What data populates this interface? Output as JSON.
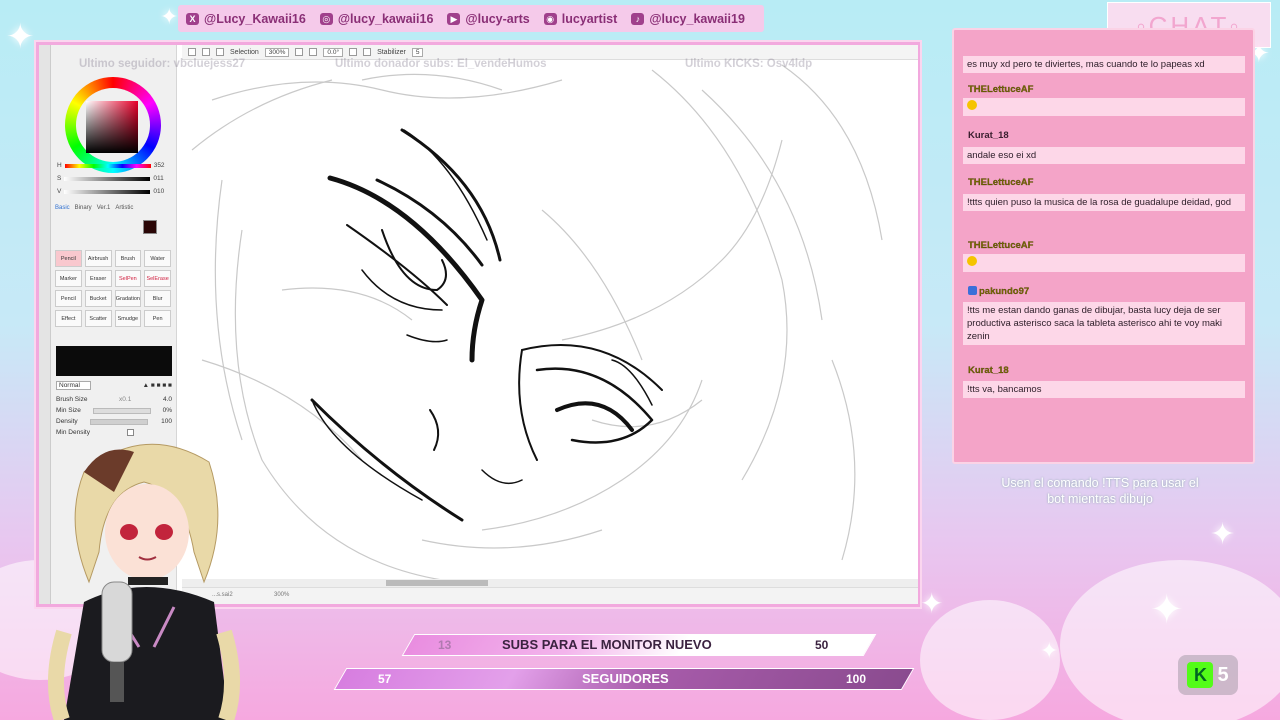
{
  "social": [
    {
      "icon": "x-icon",
      "glyph": "X",
      "handle": "@Lucy_Kawaii16"
    },
    {
      "icon": "instagram-icon",
      "glyph": "◎",
      "handle": "@lucy_kawaii16"
    },
    {
      "icon": "youtube-icon",
      "glyph": "▶",
      "handle": "@lucy-arts"
    },
    {
      "icon": "discord-icon",
      "glyph": "◉",
      "handle": "lucyartist"
    },
    {
      "icon": "tiktok-icon",
      "glyph": "♪",
      "handle": "@lucy_kawaii19"
    }
  ],
  "app": {
    "toolbar": {
      "selection": "Selection",
      "zoom": "300%",
      "angle": "0.0°",
      "stabilizer_label": "Stabilizer",
      "stabilizer_value": "5"
    },
    "color": {
      "h_label": "H",
      "h_value": "352",
      "s_label": "S",
      "s_value": "011",
      "v_label": "V",
      "v_value": "010",
      "accent": "#e8002a"
    },
    "brush_tabs": [
      "Basic",
      "Binary",
      "Ver.1",
      "Artistic"
    ],
    "tools": [
      "Pencil",
      "Airbrush",
      "Brush",
      "Water Color",
      "Marker",
      "Eraser",
      "SelPen",
      "SelErase",
      "Pencil",
      "Bucket",
      "Gradation",
      "Blur",
      "Effect",
      "Scatter",
      "Smudge",
      "Pen"
    ],
    "brush": {
      "mode": "Normal",
      "size_label": "Brush Size",
      "size_mult": "x0.1",
      "size_value": "4.0",
      "min_size_label": "Min Size",
      "min_size_value": "0%",
      "density_label": "Density",
      "density_value": "100",
      "min_density_label": "Min Density"
    },
    "overlays": {
      "follower": "Ultimo seguidor: vbcluejess27",
      "donor": "Ultimo donador subs: El_vendeHumos",
      "kicks": "Ultimo KICKS: Osv4ldp"
    },
    "status": {
      "file": "...s.sai2",
      "zoom": "300%"
    }
  },
  "chat": {
    "label": "◦CHAT◦",
    "messages": [
      {
        "user": "",
        "text": "es muy xd pero te diviertes, mas cuando te lo papeas xd"
      },
      {
        "user": "THELettuceAF",
        "text": "",
        "emote": true
      },
      {
        "user": "Kurat_18",
        "text": "andale eso ei xd"
      },
      {
        "user": "THELettuceAF",
        "text": "!ttts quien puso la musica de la rosa de guadalupe deidad, god"
      },
      {
        "user": "THELettuceAF",
        "text": "",
        "emote": true
      },
      {
        "user": "pakundo97",
        "text": "!tts me estan dando ganas de dibujar, basta lucy deja de ser productiva asterisco saca la tableta asterisco ahi te voy maki zenin",
        "badge": true
      },
      {
        "user": "Kurat_18",
        "text": "!tts va, bancamos"
      }
    ],
    "hint": "Usen el comando !TTS para usar el bot mientras dibujo"
  },
  "goals": {
    "subs": {
      "current": "13",
      "label": "SUBS PARA EL MONITOR NUEVO",
      "target": "50",
      "progress": 0.26
    },
    "followers": {
      "current": "57",
      "label": "SEGUIDORES",
      "target": "100",
      "progress": 0.57
    }
  },
  "kick": {
    "count": "5",
    "brand_color": "#53fc18"
  }
}
